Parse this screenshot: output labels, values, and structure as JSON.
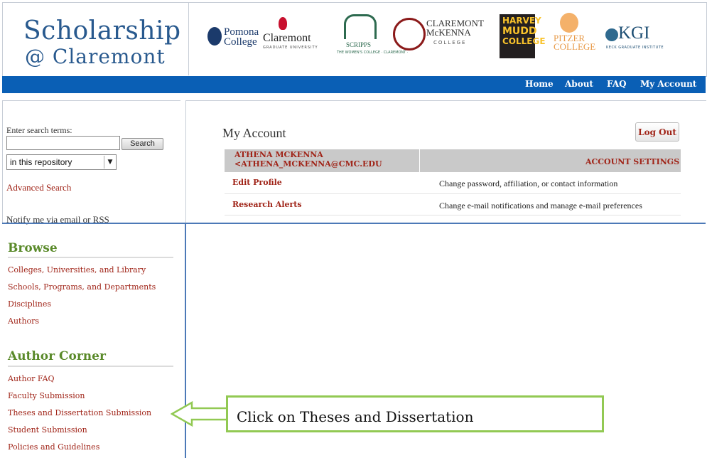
{
  "brand": {
    "logo_line1": "Scholarship",
    "logo_line2": "@ Claremont"
  },
  "colleges": {
    "pomona": "Pomona College",
    "cgu": "Claremont",
    "cgu_sub": "GRADUATE UNIVERSITY",
    "scripps": "SCRIPPS",
    "scripps_sub": "THE WOMEN'S COLLEGE · CLAREMONT ·",
    "cmc_line1": "CLAREMONT",
    "cmc_line2": "McKENNA",
    "cmc_sub": "COLLEGE",
    "hmc_lines": [
      "HARVEY",
      "MUDD",
      "COLLEGE"
    ],
    "pitzer_line1": "PITZER",
    "pitzer_line2": "COLLEGE",
    "kgi": "KGI",
    "kgi_sub": "KECK GRADUATE INSTITUTE"
  },
  "nav": {
    "home": "Home",
    "about": "About",
    "faq": "FAQ",
    "my_account": "My Account"
  },
  "search": {
    "label": "Enter search terms:",
    "value": "",
    "button": "Search",
    "scope": "in this repository",
    "advanced": "Advanced Search",
    "notify": "Notify me via email or RSS"
  },
  "account": {
    "title": "My Account",
    "logout": "Log Out",
    "name_line1": "ATHENA MCKENNA",
    "name_line2": "<ATHENA_MCKENNA@CMC.EDU",
    "settings_header": "ACCOUNT SETTINGS",
    "rows": [
      {
        "label": "Edit Profile",
        "desc": "Change password, affiliation, or contact information"
      },
      {
        "label": "Research Alerts",
        "desc": "Change e-mail notifications and manage e-mail preferences"
      }
    ]
  },
  "browse": {
    "heading": "Browse",
    "items": [
      "Colleges, Universities, and Library",
      "Schools, Programs, and Departments",
      "Disciplines",
      "Authors"
    ]
  },
  "author_corner": {
    "heading": "Author Corner",
    "items": [
      "Author FAQ",
      "Faculty Submission",
      "Theses and Dissertation Submission",
      "Student Submission",
      "Policies and Guidelines"
    ]
  },
  "callout": {
    "text": "Click on Theses and Dissertation"
  },
  "colors": {
    "nav_blue": "#0a5fb5",
    "link_red": "#a02418",
    "heading_green": "#5a8a2a",
    "callout_green": "#92c953"
  }
}
